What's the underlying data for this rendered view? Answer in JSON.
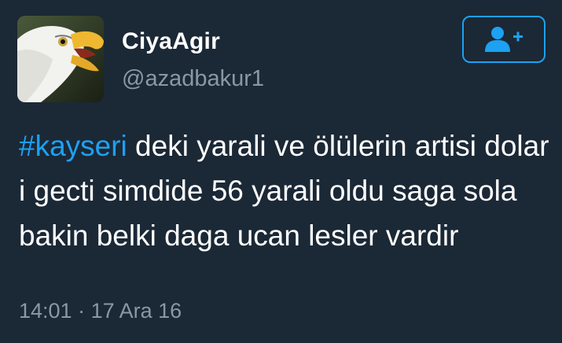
{
  "user": {
    "display_name": "CiyaAgir",
    "handle": "@azadbakur1",
    "avatar_icon": "eagle-avatar"
  },
  "follow_button": {
    "icon": "add-user-icon",
    "color": "#1da1f2"
  },
  "tweet": {
    "hashtag": "#kayseri",
    "text": " deki yarali ve ölülerin artisi dolar i gecti simdide 56 yarali oldu saga sola bakin belki daga ucan lesler vardir",
    "time": "14:01",
    "separator": "·",
    "date": "17 Ara 16"
  },
  "colors": {
    "background": "#1b2836",
    "text": "#ffffff",
    "muted": "#8899a6",
    "accent": "#1da1f2"
  }
}
